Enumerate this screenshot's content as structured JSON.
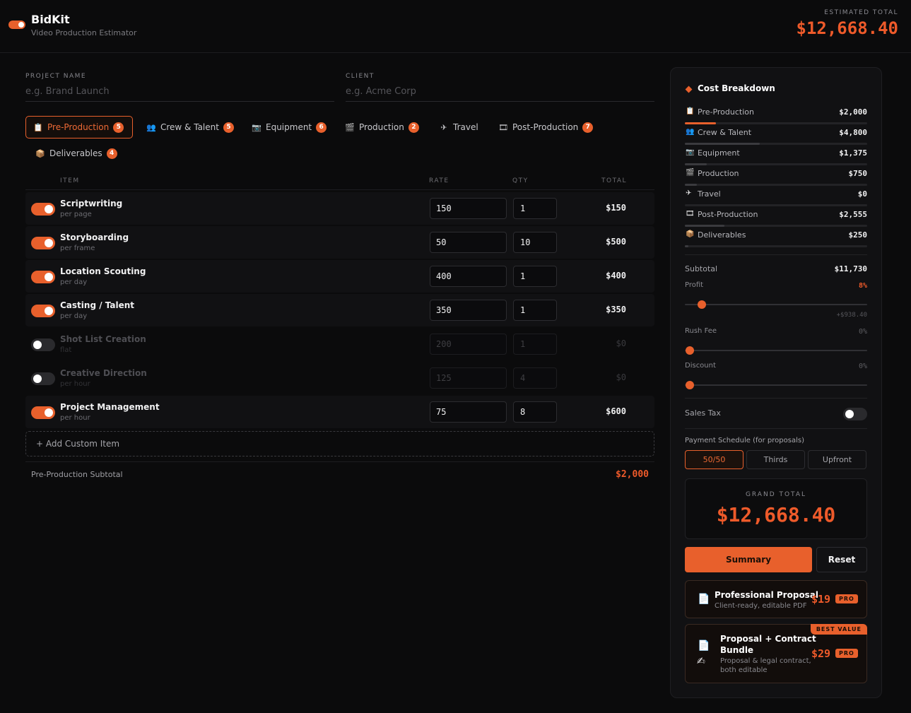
{
  "header": {
    "brand": "BidKit",
    "subtitle": "Video Production Estimator",
    "estimated_label": "ESTIMATED TOTAL",
    "estimated_value": "$12,668.40"
  },
  "project": {
    "name_label": "PROJECT NAME",
    "name_placeholder": "e.g. Brand Launch",
    "client_label": "CLIENT",
    "client_placeholder": "e.g. Acme Corp"
  },
  "tabs": [
    {
      "label": "Pre-Production",
      "icon": "📋",
      "count": "5"
    },
    {
      "label": "Crew & Talent",
      "icon": "👥",
      "count": "5"
    },
    {
      "label": "Equipment",
      "icon": "📷",
      "count": "6"
    },
    {
      "label": "Production",
      "icon": "🎬",
      "count": "2"
    },
    {
      "label": "Travel",
      "icon": "✈",
      "count": ""
    },
    {
      "label": "Post-Production",
      "icon": "🎞",
      "count": "7"
    },
    {
      "label": "Deliverables",
      "icon": "📦",
      "count": "4"
    }
  ],
  "table": {
    "headers": {
      "item": "ITEM",
      "rate": "RATE",
      "qty": "QTY",
      "total": "TOTAL"
    },
    "rows": [
      {
        "name": "Scriptwriting",
        "unit": "per page",
        "rate": "150",
        "qty": "1",
        "total": "$150",
        "enabled": true
      },
      {
        "name": "Storyboarding",
        "unit": "per frame",
        "rate": "50",
        "qty": "10",
        "total": "$500",
        "enabled": true
      },
      {
        "name": "Location Scouting",
        "unit": "per day",
        "rate": "400",
        "qty": "1",
        "total": "$400",
        "enabled": true
      },
      {
        "name": "Casting / Talent",
        "unit": "per day",
        "rate": "350",
        "qty": "1",
        "total": "$350",
        "enabled": true
      },
      {
        "name": "Shot List Creation",
        "unit": "flat",
        "rate": "200",
        "qty": "1",
        "total": "$0",
        "enabled": false
      },
      {
        "name": "Creative Direction",
        "unit": "per hour",
        "rate": "125",
        "qty": "4",
        "total": "$0",
        "enabled": false
      },
      {
        "name": "Project Management",
        "unit": "per hour",
        "rate": "75",
        "qty": "8",
        "total": "$600",
        "enabled": true
      }
    ],
    "add_custom": "+ Add Custom Item",
    "subtotal_label": "Pre-Production Subtotal",
    "subtotal_value": "$2,000"
  },
  "breakdown": {
    "title": "Cost Breakdown",
    "items": [
      {
        "name": "Pre-Production",
        "icon": "📋",
        "value": "$2,000",
        "share": 0.17
      },
      {
        "name": "Crew & Talent",
        "icon": "👥",
        "value": "$4,800",
        "share": 0.41
      },
      {
        "name": "Equipment",
        "icon": "📷",
        "value": "$1,375",
        "share": 0.12
      },
      {
        "name": "Production",
        "icon": "🎬",
        "value": "$750",
        "share": 0.064
      },
      {
        "name": "Travel",
        "icon": "✈",
        "value": "$0",
        "share": 0
      },
      {
        "name": "Post-Production",
        "icon": "🎞",
        "value": "$2,555",
        "share": 0.218
      },
      {
        "name": "Deliverables",
        "icon": "📦",
        "value": "$250",
        "share": 0.021
      }
    ],
    "subtotal_label": "Subtotal",
    "subtotal_value": "$11,730",
    "profit_label": "Profit",
    "profit_pct": "8%",
    "profit_level": 0.08,
    "profit_amount": "+$938.40",
    "rush_label": "Rush Fee",
    "rush_pct": "0%",
    "rush_level": 0,
    "discount_label": "Discount",
    "discount_pct": "0%",
    "discount_level": 0,
    "tax_label": "Sales Tax",
    "schedule_label": "Payment Schedule (for proposals)",
    "schedule_options": [
      "50/50",
      "Thirds",
      "Upfront"
    ],
    "grand_label": "GRAND TOTAL",
    "grand_value": "$12,668.40",
    "summary_label": "Summary",
    "reset_label": "Reset"
  },
  "offers": [
    {
      "title": "Professional Proposal",
      "sub": "Client-ready, editable PDF",
      "price": "$19",
      "tag": "PRO",
      "icon": "document-icon"
    },
    {
      "title_line1": "Proposal + Contract",
      "title_line2": "Bundle",
      "sub_line1": "Proposal & legal contract,",
      "sub_line2": "both editable",
      "price": "$29",
      "tag": "PRO",
      "ribbon": "BEST VALUE",
      "icon": "contract-icon"
    }
  ],
  "colors": {
    "accent": "#e8602c",
    "background": "#0b0b0c",
    "panel": "#111113"
  }
}
